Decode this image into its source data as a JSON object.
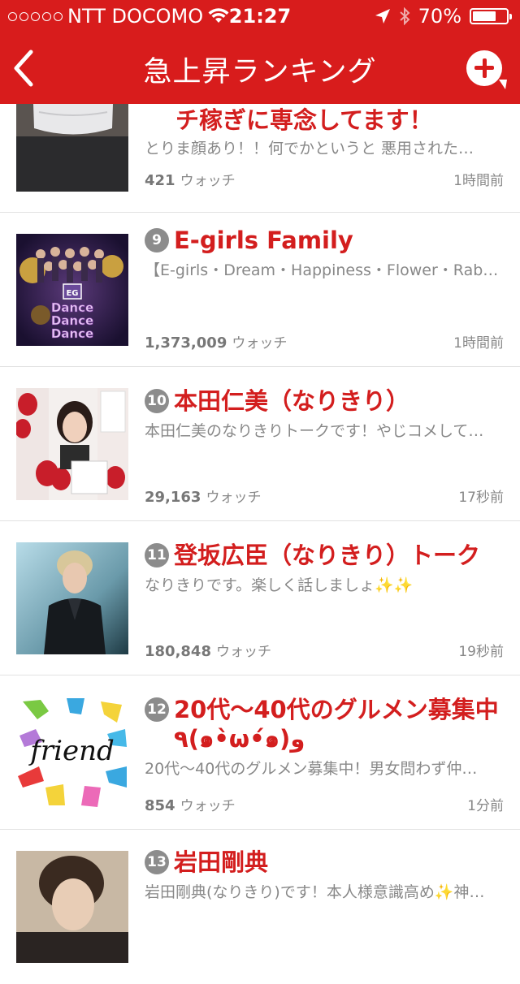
{
  "status_bar": {
    "carrier": "NTT DOCOMO",
    "time": "21:27",
    "battery": "70%",
    "battery_level": 0.7
  },
  "nav": {
    "title": "急上昇ランキング"
  },
  "rows": [
    {
      "rank": "",
      "title": "チ稼ぎに専念してます！",
      "description": "とりま顔あり！！何でかというと 悪用された…",
      "count": "421",
      "watch": "ウォッチ",
      "time": "1時間前"
    },
    {
      "rank": "9",
      "title": "E-girls Family",
      "description": "【E-girls・Dream・Happiness・Flower・Rab…",
      "count": "1,373,009",
      "watch": "ウォッチ",
      "time": "1時間前"
    },
    {
      "rank": "10",
      "title": "本田仁美（なりきり）",
      "description": "本田仁美のなりきりトークです！やじコメして…",
      "count": "29,163",
      "watch": "ウォッチ",
      "time": "17秒前"
    },
    {
      "rank": "11",
      "title": "登坂広臣（なりきり）トーク",
      "description": "なりきりです。楽しく話しましょ✨✨",
      "count": "180,848",
      "watch": "ウォッチ",
      "time": "19秒前"
    },
    {
      "rank": "12",
      "title": "20代〜40代のグルメン募集中٩(๑•̀ω•́๑)و",
      "description": "20代〜40代のグルメン募集中！男女問わず仲…",
      "count": "854",
      "watch": "ウォッチ",
      "time": "1分前"
    },
    {
      "rank": "13",
      "title": "岩田剛典",
      "description": "岩田剛典(なりきり)です！本人様意識高め✨神…",
      "count": "",
      "watch": "",
      "time": ""
    }
  ],
  "thumbnails": {
    "row9_logo_text": "Dance Dance Dance",
    "row12_word": "friend"
  }
}
